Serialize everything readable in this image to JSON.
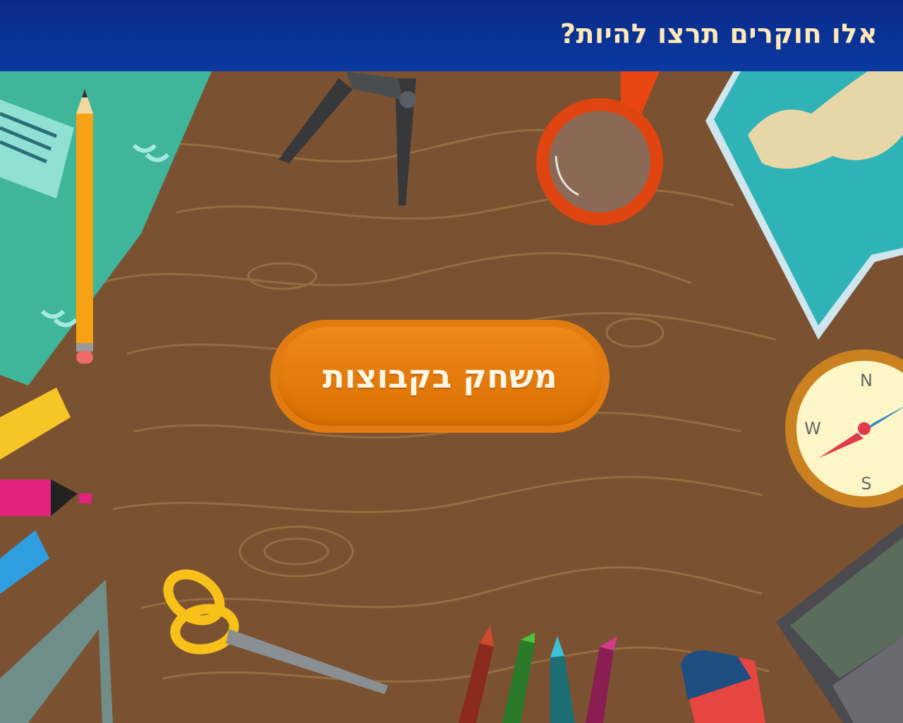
{
  "header": {
    "title": "אלו חוקרים תרצו להיות?"
  },
  "main": {
    "play_button_label": "משחק בקבוצות"
  },
  "colors": {
    "header_bg": "#0b3aa0",
    "desk_bg": "#7a5232",
    "button_bg": "#e27c10",
    "title_text": "#ffe9b8"
  },
  "compass": {
    "north": "N",
    "south": "S",
    "west": "W"
  }
}
